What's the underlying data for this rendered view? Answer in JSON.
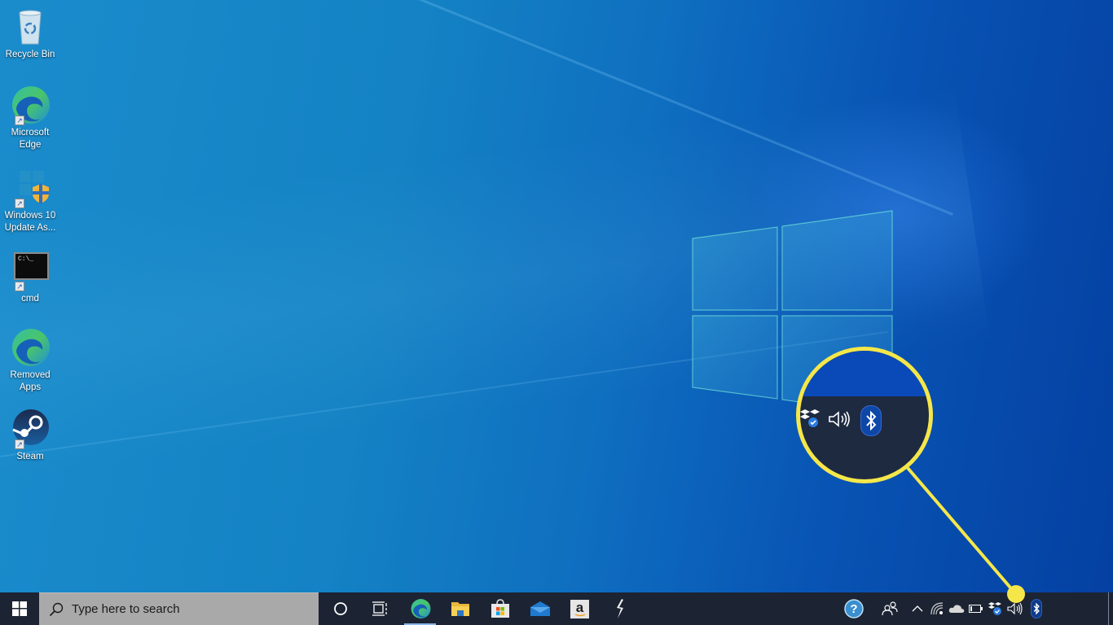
{
  "desktop": {
    "icons": [
      {
        "label": "Recycle Bin",
        "icon": "recycle-bin-icon"
      },
      {
        "label": "Microsoft Edge",
        "icon": "edge-icon"
      },
      {
        "label": "Windows 10 Update As...",
        "icon": "windows-update-assistant-icon"
      },
      {
        "label": "cmd",
        "icon": "command-prompt-icon"
      },
      {
        "label": "Removed Apps",
        "icon": "edge-icon"
      },
      {
        "label": "Steam",
        "icon": "steam-icon"
      }
    ],
    "cmd_prompt_text": "C:\\_"
  },
  "callout": {
    "color": "#f5e74a",
    "highlighted_item": "bluetooth-icon"
  },
  "taskbar": {
    "search_placeholder": "Type here to search",
    "pinned_apps": [
      {
        "name": "Cortana",
        "icon": "cortana-icon"
      },
      {
        "name": "Task View",
        "icon": "task-view-icon"
      },
      {
        "name": "Microsoft Edge",
        "icon": "edge-icon",
        "active": true
      },
      {
        "name": "File Explorer",
        "icon": "file-explorer-icon"
      },
      {
        "name": "Microsoft Store",
        "icon": "store-icon"
      },
      {
        "name": "Mail",
        "icon": "mail-icon"
      },
      {
        "name": "Amazon",
        "icon": "amazon-icon"
      },
      {
        "name": "App",
        "icon": "lightning-app-icon"
      }
    ],
    "tray": [
      {
        "name": "Help",
        "icon": "help-icon"
      },
      {
        "name": "People",
        "icon": "people-icon"
      },
      {
        "name": "Show hidden icons",
        "icon": "chevron-up-icon"
      },
      {
        "name": "Network",
        "icon": "wifi-icon"
      },
      {
        "name": "OneDrive",
        "icon": "onedrive-icon"
      },
      {
        "name": "Battery",
        "icon": "battery-icon"
      },
      {
        "name": "Dropbox",
        "icon": "dropbox-icon"
      },
      {
        "name": "Volume",
        "icon": "volume-icon"
      },
      {
        "name": "Bluetooth",
        "icon": "bluetooth-icon"
      }
    ],
    "amazon_letter": "a"
  }
}
